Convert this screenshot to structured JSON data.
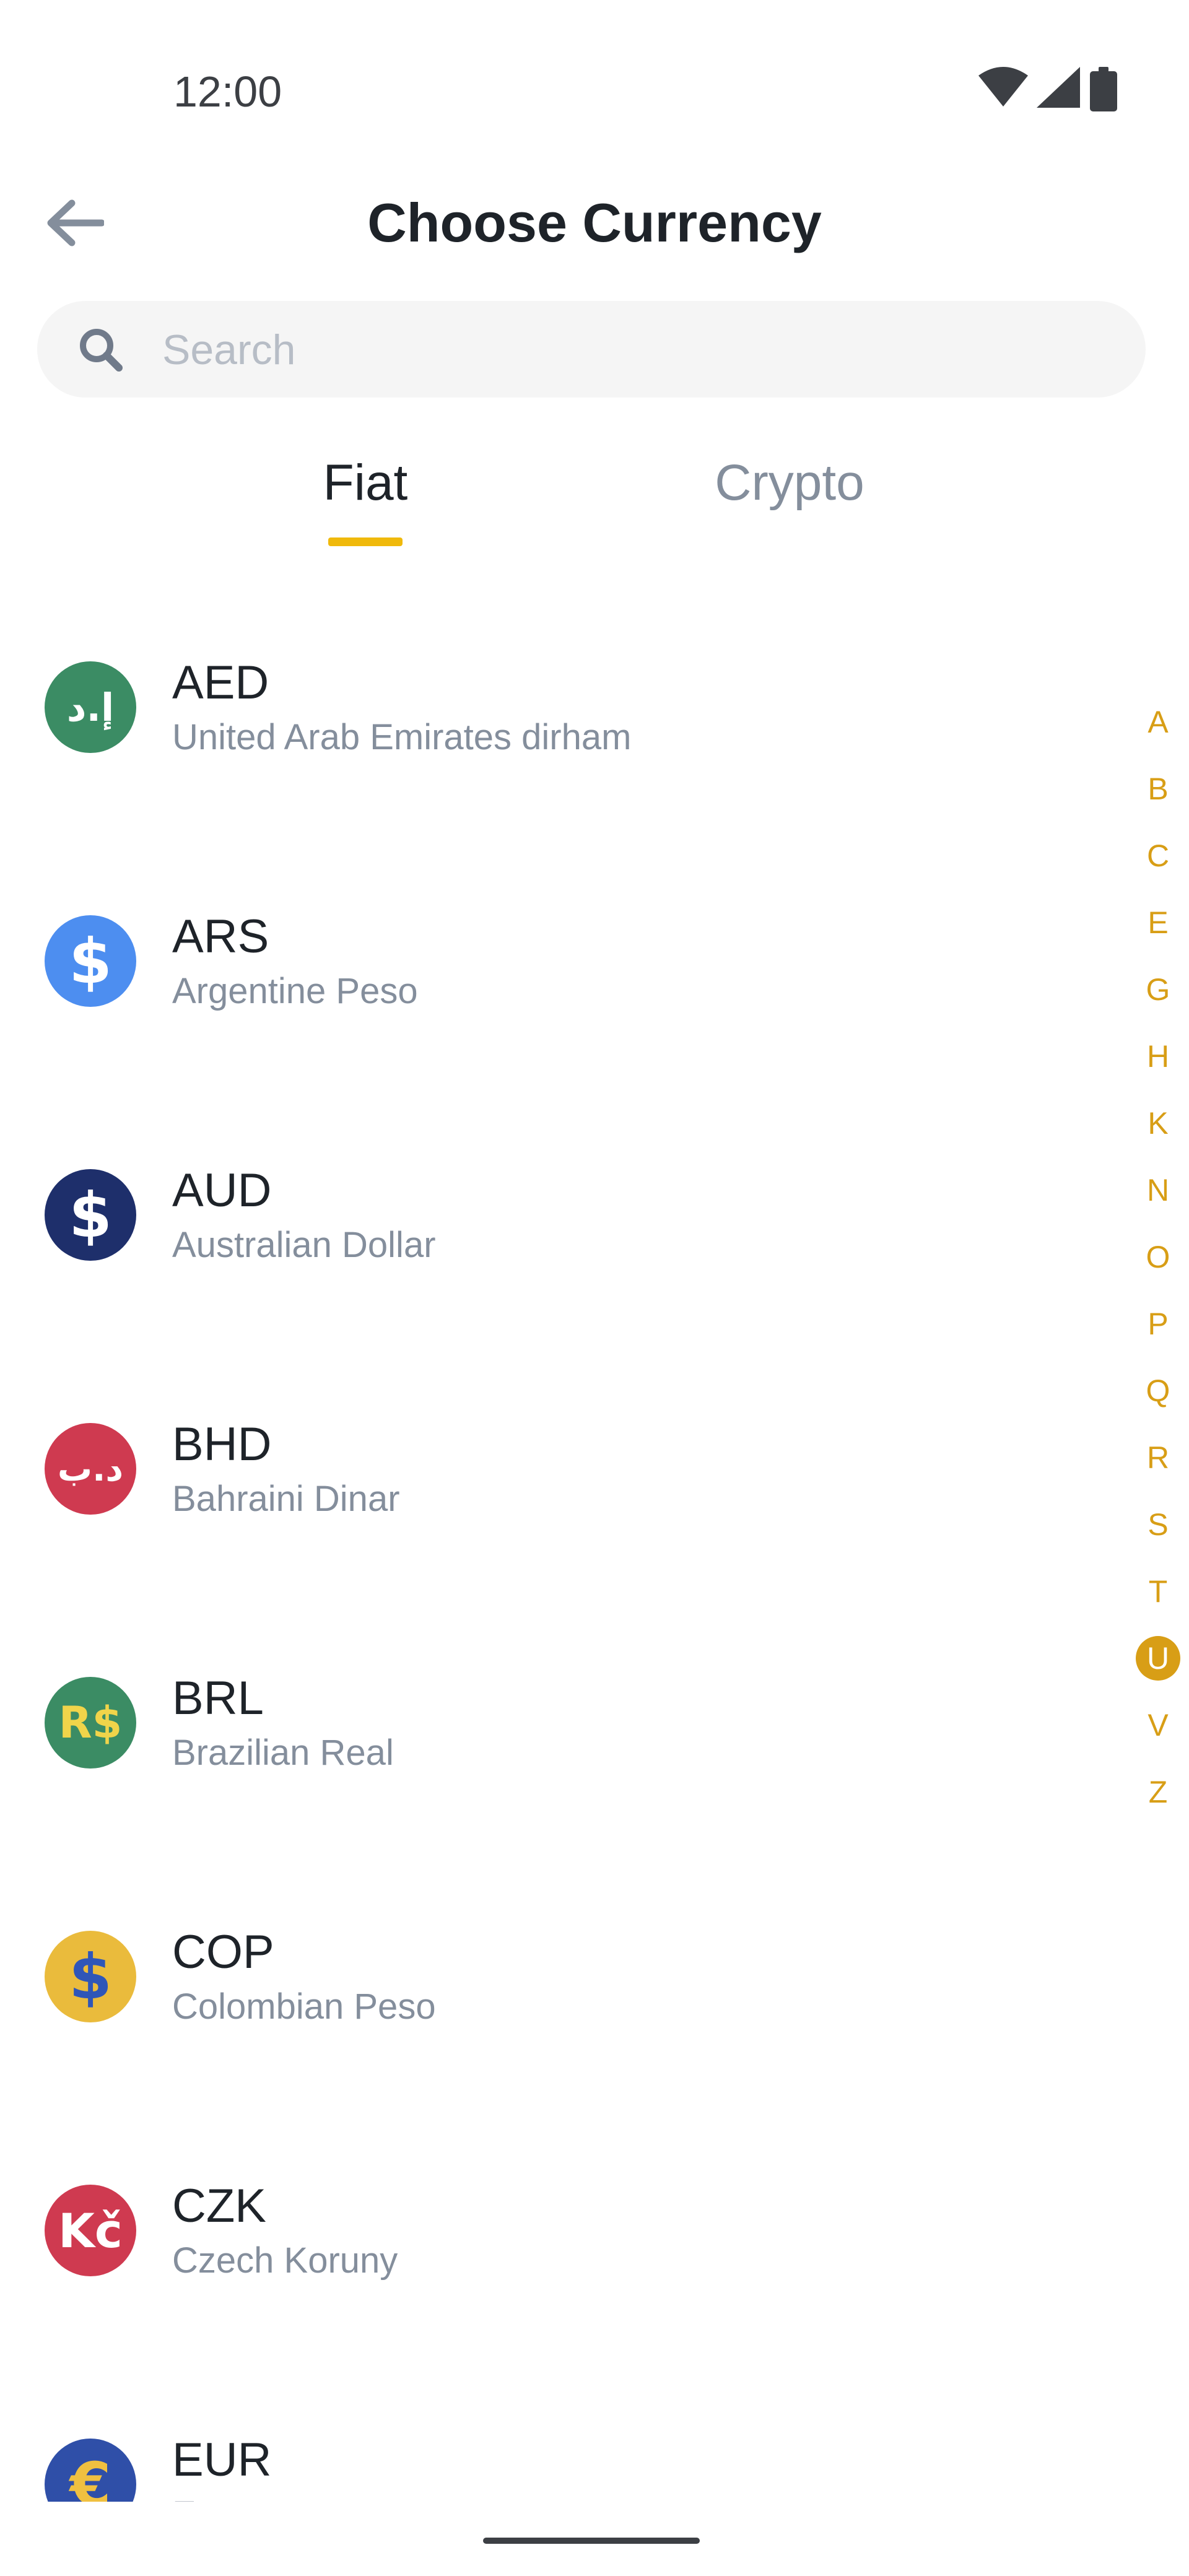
{
  "status_bar": {
    "time": "12:00",
    "icons": [
      "wifi-icon",
      "signal-icon",
      "battery-icon"
    ]
  },
  "header": {
    "back_icon": "arrow-left-icon",
    "title": "Choose Currency"
  },
  "search": {
    "icon": "search-icon",
    "placeholder": "Search",
    "value": ""
  },
  "tabs": [
    {
      "label": "Fiat",
      "active": true
    },
    {
      "label": "Crypto",
      "active": false
    }
  ],
  "currencies": [
    {
      "code": "AED",
      "name": "United Arab Emirates dirham",
      "symbol": "إ.د",
      "bg": "#3b8c64",
      "fg": "#ffffff"
    },
    {
      "code": "ARS",
      "name": "Argentine Peso",
      "symbol": "$",
      "bg": "#4d8ef0",
      "fg": "#ffffff"
    },
    {
      "code": "AUD",
      "name": "Australian Dollar",
      "symbol": "$",
      "bg": "#1e2f6b",
      "fg": "#ffffff"
    },
    {
      "code": "BHD",
      "name": "Bahraini Dinar",
      "symbol": "د.ب",
      "bg": "#cf3a50",
      "fg": "#ffffff"
    },
    {
      "code": "BRL",
      "name": "Brazilian Real",
      "symbol": "R$",
      "bg": "#3b8c64",
      "fg": "#f0d44a"
    },
    {
      "code": "COP",
      "name": "Colombian Peso",
      "symbol": "$",
      "bg": "#eabb3c",
      "fg": "#2f56b8"
    },
    {
      "code": "CZK",
      "name": "Czech Koruny",
      "symbol": "Kč",
      "bg": "#cf3a50",
      "fg": "#ffffff"
    },
    {
      "code": "EUR",
      "name": "Euro",
      "symbol": "€",
      "bg": "#2f4fa8",
      "fg": "#f0c040"
    }
  ],
  "alphabet_index": {
    "letters": [
      "A",
      "B",
      "C",
      "E",
      "G",
      "H",
      "K",
      "N",
      "O",
      "P",
      "Q",
      "R",
      "S",
      "T",
      "U",
      "V",
      "Z"
    ],
    "active": "U"
  },
  "colors": {
    "accent": "#f0b90b",
    "index_color": "#d89e16",
    "primary_text": "#1e2329",
    "secondary_text": "#848e9c"
  }
}
